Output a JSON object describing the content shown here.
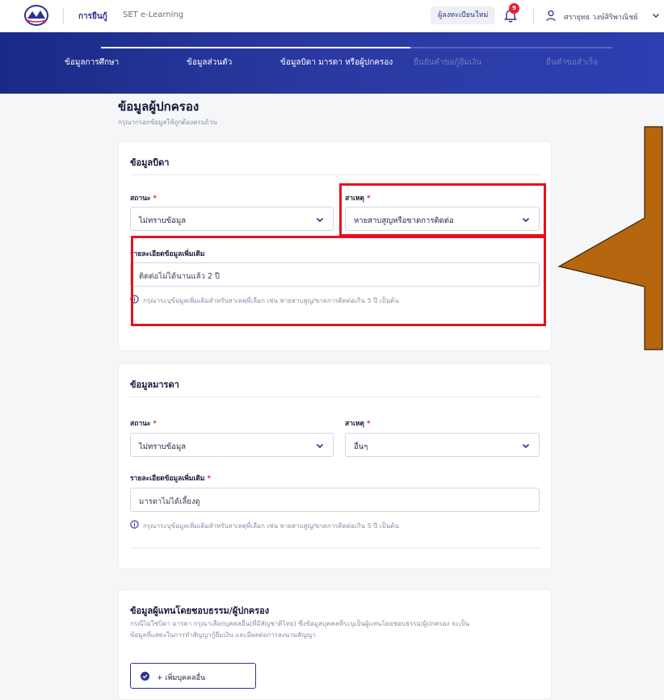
{
  "header": {
    "logo": "logo-icon",
    "nav": {
      "active": "การยืนกู้",
      "other": "SET e-Learning"
    },
    "register_label": "ผู้ลงทะเบียนใหม่",
    "notification_count": "9",
    "user_name": "ศรายุทธ วงษ์สิริพาณิชย์"
  },
  "stepper": {
    "steps": [
      {
        "label": "ข้อมูลการศึกษา",
        "state": "done"
      },
      {
        "label": "ข้อมูลส่วนตัว",
        "state": "done"
      },
      {
        "label": "ข้อมูลบิดา มารดา หรือผู้ปกครอง",
        "state": "current"
      },
      {
        "label": "ยืนยันคำขอกู้ยืมเงิน",
        "state": "todo"
      },
      {
        "label": "ยื่นคำขอสำเร็จ",
        "state": "todo"
      }
    ]
  },
  "section": {
    "title": "ข้อมูลผู้ปกครอง",
    "subtitle": "กรุณากรอกข้อมูลให้ถูกต้องครบถ้วน"
  },
  "father": {
    "title": "ข้อมูลบิดา",
    "status_label": "สถานะ",
    "status_value": "ไม่ทราบข้อมูล",
    "reason_label": "สาเหตุ",
    "reason_value": "หายสาบสูญหรือขาดการติดต่อ",
    "detail_label": "รายละเอียดข้อมูลเพิ่มเติม",
    "detail_value": "ติดต่อไม่ได้นานแล้ว 2 ปี",
    "hint": "กรุณาระบุข้อมูลเพิ่มเติมสำหรับสาเหตุที่เลือก เช่น หายสาบสูญ/ขาดการติดต่อเกิน 5 ปี เป็นต้น"
  },
  "mother": {
    "title": "ข้อมูลมารดา",
    "status_label": "สถานะ",
    "status_value": "ไม่ทราบข้อมูล",
    "reason_label": "สาเหตุ",
    "reason_value": "อื่นๆ",
    "detail_label": "รายละเอียดข้อมูลเพิ่มเติม",
    "detail_value": "มารดาไม่ได้เลี้ยงดู",
    "hint": "กรุณาระบุข้อมูลเพิ่มเติมสำหรับสาเหตุที่เลือก เช่น หายสาบสูญ/ขาดการติดต่อเกิน 5 ปี เป็นต้น"
  },
  "guardian": {
    "title": "ข้อมูลผู้แทนโดยชอบธรรม/ผู้ปกครอง",
    "desc_line1": "กรณีไม่ใช่บิดา มารดา กรุณาเลือกบุคคลอื่น(ที่มีสัญชาติไทย) ซึ่งข้อมูลบุคคลที่ระบุเป็นผู้แทนโดยชอบธรรม/ผู้ปกครอง จะเป็น",
    "desc_line2": "ข้อมูลที่แสดงในการทำสัญญากู้ยืมเงิน และมีผลต่อการลงนามสัญญา",
    "add_button": "+ เพิ่มบุคคลอื่น"
  },
  "colors": {
    "primary": "#2e3192",
    "stepper_bg": "#1f2f94",
    "highlight": "#e8101c",
    "arrow": "#b5660f",
    "required": "#e8202f"
  }
}
